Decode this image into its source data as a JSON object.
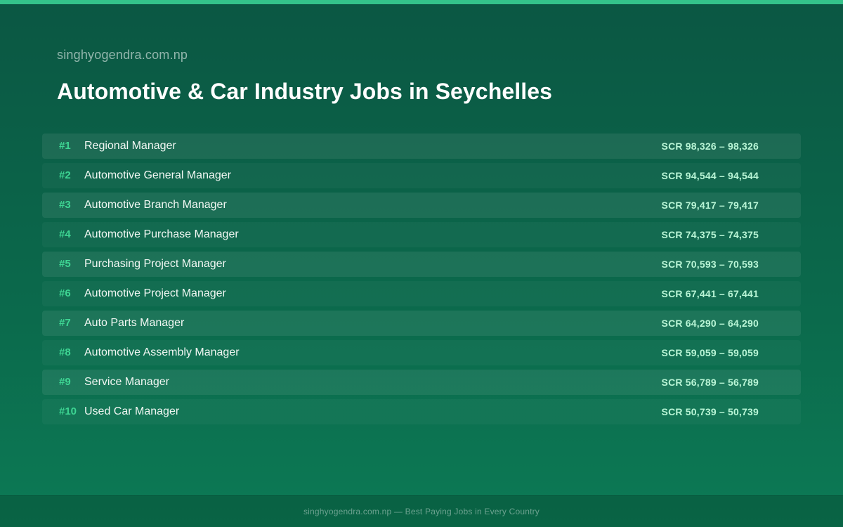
{
  "site_label": "singhyogendra.com.np",
  "title": "Automotive & Car Industry Jobs in Seychelles",
  "jobs": [
    {
      "rank": "#1",
      "title": "Regional Manager",
      "salary": "SCR 98,326 – 98,326"
    },
    {
      "rank": "#2",
      "title": "Automotive General Manager",
      "salary": "SCR 94,544 – 94,544"
    },
    {
      "rank": "#3",
      "title": "Automotive Branch Manager",
      "salary": "SCR 79,417 – 79,417"
    },
    {
      "rank": "#4",
      "title": "Automotive Purchase Manager",
      "salary": "SCR 74,375 – 74,375"
    },
    {
      "rank": "#5",
      "title": "Purchasing Project Manager",
      "salary": "SCR 70,593 – 70,593"
    },
    {
      "rank": "#6",
      "title": "Automotive Project Manager",
      "salary": "SCR 67,441 – 67,441"
    },
    {
      "rank": "#7",
      "title": "Auto Parts Manager",
      "salary": "SCR 64,290 – 64,290"
    },
    {
      "rank": "#8",
      "title": "Automotive Assembly Manager",
      "salary": "SCR 59,059 – 59,059"
    },
    {
      "rank": "#9",
      "title": "Service Manager",
      "salary": "SCR 56,789 – 56,789"
    },
    {
      "rank": "#10",
      "title": "Used Car Manager",
      "salary": "SCR 50,739 – 50,739"
    }
  ],
  "footer": "singhyogendra.com.np — Best Paying Jobs in Every Country",
  "colors": {
    "accent": "#34c38a",
    "rank": "#3ed593",
    "salary": "#b9f5d6",
    "background": "#0b6a4c"
  }
}
